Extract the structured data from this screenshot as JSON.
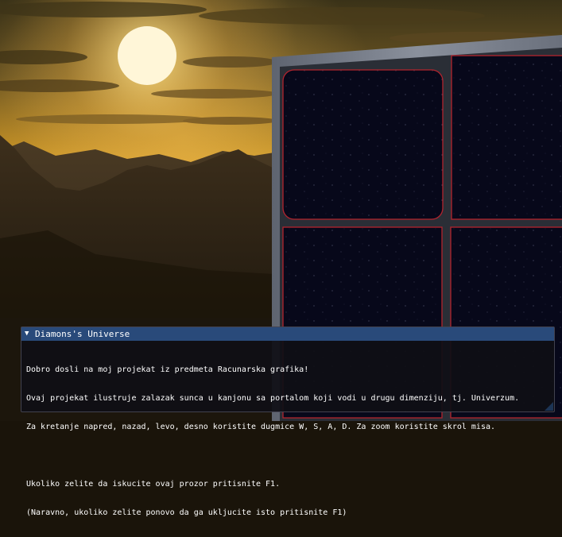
{
  "window": {
    "title": "Diamons's Universe",
    "lines": [
      "Dobro dosli na moj projekat iz predmeta Racunarska grafika!",
      "Ovaj projekat ilustruje zalazak sunca u kanjonu sa portalom koji vodi u drugu dimenziju, tj. Univerzum.",
      "Za kretanje napred, nazad, levo, desno koristite dugmice W, S, A, D. Za zoom koristite skrol misa.",
      "",
      "Ukoliko zelite da iskucite ovaj prozor pritisnite F1.",
      "(Naravno, ukoliko zelite ponovo da ga ukljucite isto pritisnite F1)"
    ]
  },
  "icons": {
    "collapse": "triangle-down-icon",
    "resize": "resize-grip-icon"
  },
  "colors": {
    "title_bar": "#294a7a",
    "window_bg": "#0f0f16",
    "text": "#ffffff",
    "portal_glow": "#b3242e"
  }
}
